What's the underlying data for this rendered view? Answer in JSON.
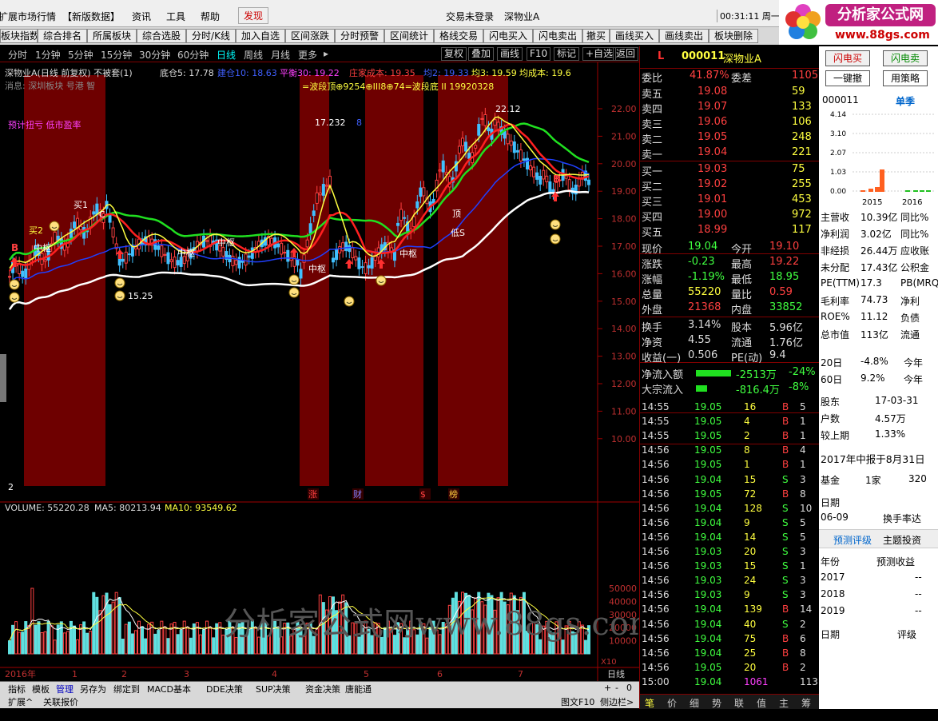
{
  "menu": {
    "items": [
      "扩展市场行情",
      "【新版数据】",
      "资讯",
      "工具",
      "帮助",
      "发现"
    ],
    "login": "交易未登录",
    "stock": "深物业A",
    "clock": "00:31:11 周一"
  },
  "logo": {
    "text": "分析家公式网",
    "url": "www.88gs.com"
  },
  "toolbar": [
    "板块指数",
    "综合排名",
    "所属板块",
    "综合选股",
    "分时/K线",
    "加入自选",
    "区间涨跌",
    "分时预警",
    "区间统计",
    "格线交易",
    "闪电买入",
    "闪电卖出",
    "撤买",
    "画线买入",
    "画线卖出",
    "板块删除"
  ],
  "periods": [
    "分时",
    "1分钟",
    "5分钟",
    "15分钟",
    "30分钟",
    "60分钟",
    "日线",
    "周线",
    "月线",
    "更多"
  ],
  "period_right": [
    "复权",
    "叠加",
    "画线",
    "F10",
    "标记",
    "+自选",
    "返回"
  ],
  "chart_header": {
    "name": "深物业A(日线 前复权) 不被套(1)",
    "bottom": "底仓5: 17.78",
    "jc": "建仓10: 18.63",
    "ph": "平衡30: 19.22",
    "zj": "庄家成本: 19.35",
    "j2": "均2: 19.33",
    "j3": "均3: 19.59",
    "jcb": "均成本: 19.6",
    "line2": "=波段顶⊕9254⊕III8⊕74=波段底 II 19920328",
    "red_text": "预计扭亏 低市盈率",
    "left_text": "消息: 深圳板块 号港 智"
  },
  "price_axis": [
    "22.00",
    "21.00",
    "20.00",
    "19.00",
    "18.00",
    "17.00",
    "16.00",
    "15.00",
    "14.00",
    "13.00",
    "12.00",
    "11.00",
    "10.00"
  ],
  "vol_axis": [
    "50000",
    "40000",
    "30000",
    "20000",
    "10000",
    "X10"
  ],
  "date_axis": [
    "2016年",
    "1",
    "2",
    "3",
    "4",
    "5",
    "6",
    "7",
    "日线"
  ],
  "chart_labels": {
    "high": "22.12",
    "mid_high": "17.232",
    "low": "15.25",
    "mid": "8",
    "zs": "中枢",
    "buy2": "买2",
    "buy1": "买1",
    "top": "顶",
    "lows": "低S",
    "C": "C",
    "B": "B",
    "two": "2"
  },
  "bottom_markers": [
    "涨",
    "财",
    "$",
    "榜"
  ],
  "volume_header": {
    "vol": "VOLUME: 55220.28",
    "ma5": "MA5: 80213.94",
    "ma10": "MA10: 93549.62"
  },
  "watermark": "分析家公式网www.88gs.com",
  "bottom_tabs": [
    "指标",
    "模板",
    "管理",
    "另存为",
    "绑定到",
    "MACD基本",
    "DDE决策",
    "SUP决策",
    "资金决策",
    "唐能通"
  ],
  "bottom_tabs2": [
    "扩展^",
    "关联报价"
  ],
  "bottom_right": [
    "图文F10",
    "侧边栏>"
  ],
  "quote": {
    "code": "000011",
    "name": "深物业A",
    "L": "L",
    "wb": {
      "label": "委比",
      "val": "41.87%",
      "label2": "委差",
      "val2": "1105"
    },
    "sells": [
      [
        "卖五",
        "19.08",
        "59"
      ],
      [
        "卖四",
        "19.07",
        "133"
      ],
      [
        "卖三",
        "19.06",
        "106"
      ],
      [
        "卖二",
        "19.05",
        "248"
      ],
      [
        "卖一",
        "19.04",
        "221"
      ]
    ],
    "buys": [
      [
        "买一",
        "19.03",
        "75"
      ],
      [
        "买二",
        "19.02",
        "255"
      ],
      [
        "买三",
        "19.01",
        "453"
      ],
      [
        "买四",
        "19.00",
        "972"
      ],
      [
        "买五",
        "18.99",
        "117"
      ]
    ],
    "stats": [
      [
        "现价",
        "19.04",
        "今开",
        "19.10"
      ],
      [
        "涨跌",
        "-0.23",
        "最高",
        "19.22"
      ],
      [
        "涨幅",
        "-1.19%",
        "最低",
        "18.95"
      ],
      [
        "总量",
        "55220",
        "量比",
        "0.59"
      ],
      [
        "外盘",
        "21368",
        "内盘",
        "33852"
      ]
    ],
    "stats2": [
      [
        "换手",
        "3.14%",
        "股本",
        "5.96亿"
      ],
      [
        "净资",
        "4.55",
        "流通",
        "1.76亿"
      ],
      [
        "收益(一)",
        "0.506",
        "PE(动)",
        "9.4"
      ]
    ],
    "flows": [
      [
        "净流入额",
        "-2513万",
        "-24%"
      ],
      [
        "大宗流入",
        "-816.4万",
        "-8%"
      ]
    ],
    "ticks": [
      [
        "14:55",
        "19.05",
        "16",
        "B",
        "5"
      ],
      [
        "14:55",
        "19.05",
        "4",
        "B",
        "1"
      ],
      [
        "14:55",
        "19.05",
        "2",
        "B",
        "1"
      ],
      [
        "14:56",
        "19.05",
        "8",
        "B",
        "4"
      ],
      [
        "14:56",
        "19.05",
        "1",
        "B",
        "1"
      ],
      [
        "14:56",
        "19.04",
        "15",
        "S",
        "3"
      ],
      [
        "14:56",
        "19.05",
        "72",
        "B",
        "8"
      ],
      [
        "14:56",
        "19.04",
        "128",
        "S",
        "10"
      ],
      [
        "14:56",
        "19.04",
        "9",
        "S",
        "5"
      ],
      [
        "14:56",
        "19.04",
        "14",
        "S",
        "5"
      ],
      [
        "14:56",
        "19.03",
        "20",
        "S",
        "3"
      ],
      [
        "14:56",
        "19.03",
        "15",
        "S",
        "1"
      ],
      [
        "14:56",
        "19.03",
        "24",
        "S",
        "3"
      ],
      [
        "14:56",
        "19.03",
        "9",
        "S",
        "3"
      ],
      [
        "14:56",
        "19.04",
        "139",
        "B",
        "14"
      ],
      [
        "14:56",
        "19.04",
        "40",
        "S",
        "2"
      ],
      [
        "14:56",
        "19.04",
        "75",
        "B",
        "6"
      ],
      [
        "14:56",
        "19.04",
        "25",
        "B",
        "8"
      ],
      [
        "14:56",
        "19.05",
        "20",
        "B",
        "2"
      ],
      [
        "15:00",
        "19.04",
        "1061",
        "",
        "113"
      ]
    ],
    "tabs": [
      "笔",
      "价",
      "细",
      "势",
      "联",
      "值",
      "主",
      "筹"
    ]
  },
  "info": {
    "buttons": [
      "闪电买",
      "闪电卖",
      "一键撤",
      "用策略"
    ],
    "code": "000011",
    "mode": "单季",
    "chart": {
      "yticks": [
        "4.14",
        "3.10",
        "2.07",
        "1.03",
        "0.00"
      ],
      "years": [
        "2015",
        "2016"
      ]
    },
    "fin": [
      [
        "主营收",
        "10.39亿",
        "同比%"
      ],
      [
        "净利润",
        "3.02亿",
        "同比%"
      ],
      [
        "非经损",
        "26.44万",
        "应收账"
      ],
      [
        "未分配",
        "17.43亿",
        "公积金"
      ],
      [
        "PE(TTM)",
        "17.3",
        "PB(MRQ)"
      ],
      [
        "毛利率",
        "74.73",
        "净利"
      ],
      [
        "ROE%",
        "11.12",
        "负债"
      ],
      [
        "总市值",
        "113亿",
        "流通"
      ]
    ],
    "perf": [
      [
        "20日",
        "-4.8%",
        "今年"
      ],
      [
        "60日",
        "9.2%",
        "今年"
      ]
    ],
    "holders": [
      [
        "股东",
        "17-03-31"
      ],
      [
        "户数",
        "4.57万"
      ],
      [
        "较上期",
        "1.33%"
      ]
    ],
    "report": "2017年中报于8月31日",
    "fund": [
      "基金",
      "1家",
      "320"
    ],
    "date": [
      "日期",
      "换手率达"
    ],
    "date_val": "06-09",
    "forecast_tabs": [
      "预测评级",
      "主题投资"
    ],
    "fc_head": [
      "年份",
      "预测收益"
    ],
    "fc": [
      [
        "2017",
        "--"
      ],
      [
        "2018",
        "--"
      ],
      [
        "2019",
        "--"
      ]
    ],
    "rating_head": [
      "日期",
      "评级"
    ]
  }
}
